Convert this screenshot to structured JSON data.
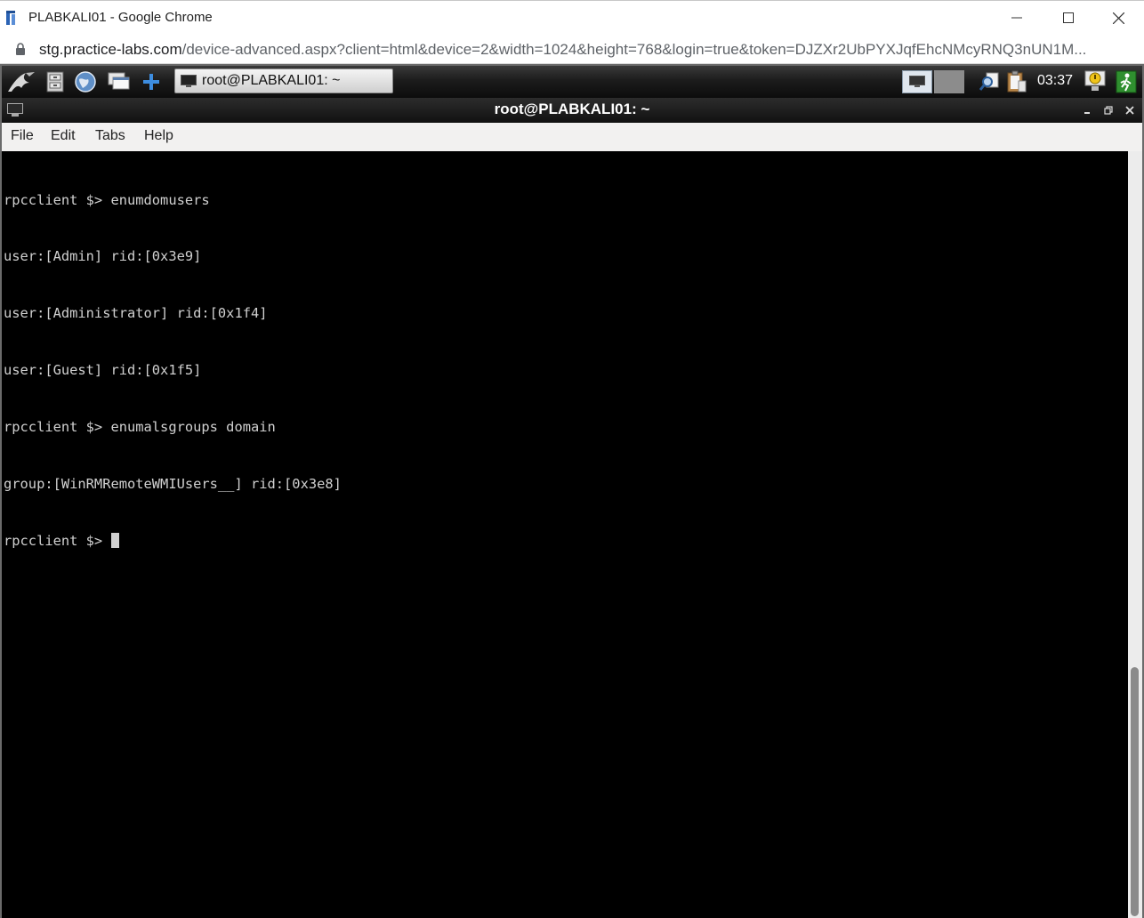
{
  "browser": {
    "window_title": "PLABKALI01 - Google Chrome",
    "url_host": "stg.practice-labs.com",
    "url_path": "/device-advanced.aspx?client=html&device=2&width=1024&height=768&login=true&token=DJZXr2UbPYXJqfEhcNMcyRNQ3nUN1M..."
  },
  "panel": {
    "task_label": "root@PLABKALI01: ~",
    "clock": "03:37"
  },
  "terminal_window": {
    "title": "root@PLABKALI01: ~",
    "menu": {
      "file": "File",
      "edit": "Edit",
      "tabs": "Tabs",
      "help": "Help"
    },
    "lines": [
      "rpcclient $> enumdomusers",
      "user:[Admin] rid:[0x3e9]",
      "user:[Administrator] rid:[0x1f4]",
      "user:[Guest] rid:[0x1f5]",
      "rpcclient $> enumalsgroups domain",
      "group:[WinRMRemoteWMIUsers__] rid:[0x3e8]"
    ],
    "prompt": "rpcclient $> "
  }
}
